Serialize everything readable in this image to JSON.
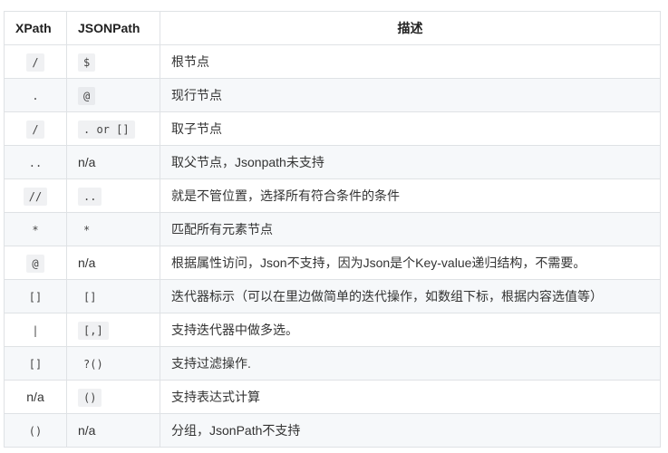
{
  "headers": [
    "XPath",
    "JSONPath",
    "描述"
  ],
  "rows": [
    {
      "xpath": "/",
      "xpath_code": true,
      "jsonpath": "$",
      "jsonpath_code": true,
      "desc": "根节点"
    },
    {
      "xpath": ".",
      "xpath_code": false,
      "jsonpath": "@",
      "jsonpath_code": true,
      "desc": "现行节点"
    },
    {
      "xpath": "/",
      "xpath_code": true,
      "jsonpath": ". or []",
      "jsonpath_code": true,
      "desc": "取子节点"
    },
    {
      "xpath": "..",
      "xpath_code": false,
      "jsonpath": "n/a",
      "jsonpath_code": false,
      "desc": "取父节点，Jsonpath未支持"
    },
    {
      "xpath": "//",
      "xpath_code": true,
      "jsonpath": "..",
      "jsonpath_code": true,
      "desc": "就是不管位置，选择所有符合条件的条件"
    },
    {
      "xpath": "*",
      "xpath_code": false,
      "jsonpath": "*",
      "jsonpath_code": false,
      "desc": "匹配所有元素节点"
    },
    {
      "xpath": "@",
      "xpath_code": true,
      "jsonpath": "n/a",
      "jsonpath_code": false,
      "desc": "根据属性访问，Json不支持，因为Json是个Key-value递归结构，不需要。"
    },
    {
      "xpath": "[]",
      "xpath_code": false,
      "jsonpath": "[]",
      "jsonpath_code": false,
      "desc": "迭代器标示（可以在里边做简单的迭代操作，如数组下标，根据内容选值等）"
    },
    {
      "xpath": "|",
      "xpath_code": false,
      "jsonpath": "[,]",
      "jsonpath_code": true,
      "desc": "支持迭代器中做多选。"
    },
    {
      "xpath": "[]",
      "xpath_code": false,
      "jsonpath": "?()",
      "jsonpath_code": false,
      "desc": "支持过滤操作."
    },
    {
      "xpath": "n/a",
      "xpath_code": false,
      "jsonpath": "()",
      "jsonpath_code": true,
      "desc": "支持表达式计算"
    },
    {
      "xpath": "()",
      "xpath_code": false,
      "jsonpath": "n/a",
      "jsonpath_code": false,
      "desc": "分组，JsonPath不支持"
    }
  ]
}
